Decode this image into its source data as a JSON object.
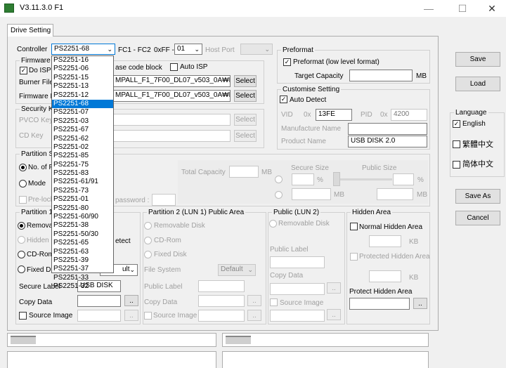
{
  "window": {
    "title": "V3.11.3.0 F1",
    "minimize": "—",
    "maximize": "☐",
    "close": "✕"
  },
  "tab": "Drive Setting",
  "controller": {
    "label": "Controller",
    "selected": "PS2251-68",
    "options": [
      "PS2251-16",
      "PS2251-06",
      "PS2251-15",
      "PS2251-13",
      "PS2251-12",
      "PS2251-68",
      "PS2251-07",
      "PS2251-03",
      "PS2251-67",
      "PS2251-62",
      "PS2251-02",
      "PS2251-85",
      "PS2251-75",
      "PS2251-83",
      "PS2251-61/91",
      "PS2251-73",
      "PS2251-01",
      "PS2251-80",
      "PS2251-60/90",
      "PS2251-38",
      "PS2251-50/30",
      "PS2251-65",
      "PS2251-63",
      "PS2251-39",
      "PS2251-37",
      "PS2251-33",
      "PS2251-32"
    ],
    "fc_label": "FC1 - FC2",
    "fc_value": "0xFF -",
    "fc_select": "01",
    "host_port_label": "Host Port"
  },
  "firmware": {
    "title": "Firmware",
    "do_isp": "Do ISP",
    "use_code_block": "ase code block",
    "auto_isp": "Auto ISP",
    "burner_label": "Burner File",
    "burner_value": "MPALL_F1_7F00_DL07_v503_0A₩MP/",
    "firmware_label": "Firmware F",
    "firmware_value": "MPALL_F1_7F00_DL07_v503_0A₩MP/",
    "select": "Select"
  },
  "security": {
    "title": "Security Ke",
    "pvco_label": "PVCO Key",
    "cd_label": "CD Key",
    "select": "Select"
  },
  "partition_setting": {
    "title": "Partition S",
    "num_label": "No. of P",
    "mode_label": "Mode",
    "prelock": "Pre-lock",
    "password": "password :",
    "total_capacity": "Total Capacity",
    "mb": "MB",
    "secure_size": "Secure Size",
    "public_size": "Public Size",
    "percent": "%"
  },
  "partition1": {
    "title": "Partition 1",
    "removable": "Remova",
    "hidden": "Hidden S",
    "detect": "etect",
    "cdrom": "CD-Rom",
    "fixed": "Fixed Di",
    "fs_value": "ult",
    "secure_label": "Secure Label",
    "secure_value": "USB DISK",
    "copy_data": "Copy Data",
    "source_image": "Source Image",
    "browse": ".."
  },
  "partition2": {
    "title": "Partition 2 (LUN 1) Public Area",
    "removable": "Removable Disk",
    "cdrom": "CD-Rom",
    "fixed": "Fixed Disk",
    "file_system": "File System",
    "fs_value": "Default",
    "public_label": "Public Label",
    "copy_data": "Copy Data",
    "source_image": "Source Image",
    "browse": ".."
  },
  "public_lun2": {
    "title": "Public (LUN 2)",
    "removable": "Removable Disk",
    "public_label": "Public Label",
    "copy_data": "Copy Data",
    "source_image": "Source Image",
    "browse": ".."
  },
  "hidden_area": {
    "title": "Hidden Area",
    "normal": "Normal Hidden Area",
    "kb": "KB",
    "protected": "Protected Hidden Area",
    "protect": "Protect Hidden Area",
    "browse": ".."
  },
  "preformat": {
    "title": "Preformat",
    "preformat_label": "Preformat (low level format)",
    "target_capacity": "Target Capacity",
    "mb": "MB"
  },
  "customise": {
    "title": "Customise Setting",
    "auto_detect": "Auto Detect",
    "vid_label": "VID",
    "hex": "0x",
    "vid_value": "13FE",
    "pid_label": "PID",
    "pid_value": "4200",
    "manufacture_label": "Manufacture Name",
    "product_label": "Product Name",
    "product_value": "USB DISK 2.0"
  },
  "buttons": {
    "save": "Save",
    "load": "Load",
    "save_as": "Save As",
    "cancel": "Cancel"
  },
  "language": {
    "title": "Language",
    "english": "English",
    "trad_chinese": "繁體中文",
    "simp_chinese": "简体中文"
  }
}
